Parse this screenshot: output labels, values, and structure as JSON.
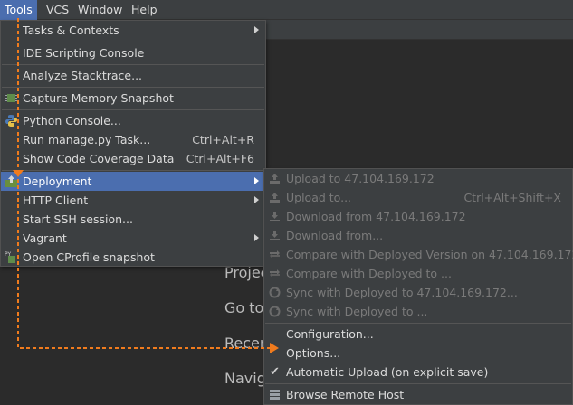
{
  "menubar": {
    "items": [
      {
        "label": "Tools",
        "active": true
      },
      {
        "label": "VCS"
      },
      {
        "label": "Window"
      },
      {
        "label": "Help"
      }
    ]
  },
  "welcome": {
    "lines": [
      "Projec",
      "Go to",
      "Recen",
      "Navig"
    ]
  },
  "tools_menu": {
    "items": [
      {
        "label": "Tasks & Contexts",
        "submenu": true
      },
      {
        "label": "IDE Scripting Console"
      },
      {
        "label": "Analyze Stacktrace..."
      },
      {
        "label": "Capture Memory Snapshot",
        "icon": "memory-snapshot-icon"
      },
      {
        "label": "Python Console...",
        "icon": "python-icon"
      },
      {
        "label": "Run manage.py Task...",
        "shortcut": "Ctrl+Alt+R"
      },
      {
        "label": "Show Code Coverage Data",
        "shortcut": "Ctrl+Alt+F6"
      },
      {
        "label": "Deployment",
        "submenu": true,
        "selected": true,
        "icon": "deployment-icon"
      },
      {
        "label": "HTTP Client",
        "submenu": true
      },
      {
        "label": "Start SSH session..."
      },
      {
        "label": "Vagrant",
        "submenu": true
      },
      {
        "label": "Open CProfile snapshot",
        "icon": "cprofile-icon"
      }
    ]
  },
  "deployment_menu": {
    "items": [
      {
        "label": "Upload to 47.104.169.172",
        "disabled": true,
        "icon": "upload-icon"
      },
      {
        "label": "Upload to...",
        "disabled": true,
        "shortcut": "Ctrl+Alt+Shift+X",
        "icon": "upload-icon"
      },
      {
        "label": "Download from 47.104.169.172",
        "disabled": true,
        "icon": "download-icon"
      },
      {
        "label": "Download from...",
        "disabled": true,
        "icon": "download-icon"
      },
      {
        "label": "Compare with Deployed Version on 47.104.169.172",
        "disabled": true,
        "icon": "compare-icon"
      },
      {
        "label": "Compare with Deployed to ...",
        "disabled": true,
        "icon": "compare-icon"
      },
      {
        "label": "Sync with Deployed to 47.104.169.172...",
        "disabled": true,
        "icon": "sync-icon"
      },
      {
        "label": "Sync with Deployed to ...",
        "disabled": true,
        "icon": "sync-icon"
      },
      {
        "label": "Configuration..."
      },
      {
        "label": "Options..."
      },
      {
        "label": "Automatic Upload (on explicit save)",
        "checked": true
      },
      {
        "label": "Browse Remote Host",
        "icon": "remote-host-icon"
      }
    ]
  },
  "colors": {
    "menu_bg": "#3c3f41",
    "selection": "#4b6eaf",
    "guide_arrow": "#f07b1d"
  }
}
